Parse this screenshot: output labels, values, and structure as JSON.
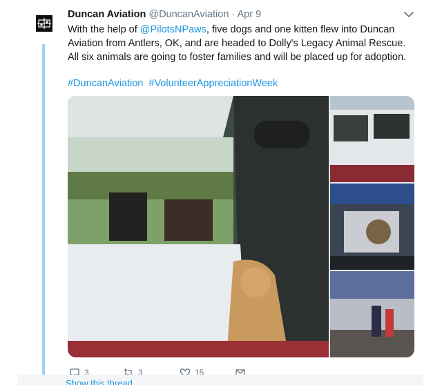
{
  "tweet": {
    "author_name": "Duncan Aviation",
    "handle": "@DuncanAviation",
    "separator": "·",
    "date": "Apr 9",
    "text_before_mention": "With the help of ",
    "mention": "@PilotsNPaws",
    "text_after_mention": ", five dogs and one kitten flew into Duncan Aviation from Antlers, OK, and are headed to Dolly's Legacy Animal Rescue. All six animals are going to foster families and will be placed up for adoption.",
    "hashtags": [
      "#DuncanAviation",
      "#VolunteerAppreciationWeek"
    ]
  },
  "actions": {
    "reply_count": "3",
    "retweet_count": "3",
    "like_count": "15"
  },
  "thread": {
    "show_thread_label": "Show this thread"
  },
  "icons": {
    "avatar": "duncan-aviation-logo",
    "more": "chevron-down-icon",
    "reply": "reply-icon",
    "retweet": "retweet-icon",
    "like": "heart-icon",
    "message": "envelope-icon"
  },
  "colors": {
    "link": "#1b95e0",
    "secondary_text": "#657786",
    "thread_line": "#9ed3f2"
  }
}
